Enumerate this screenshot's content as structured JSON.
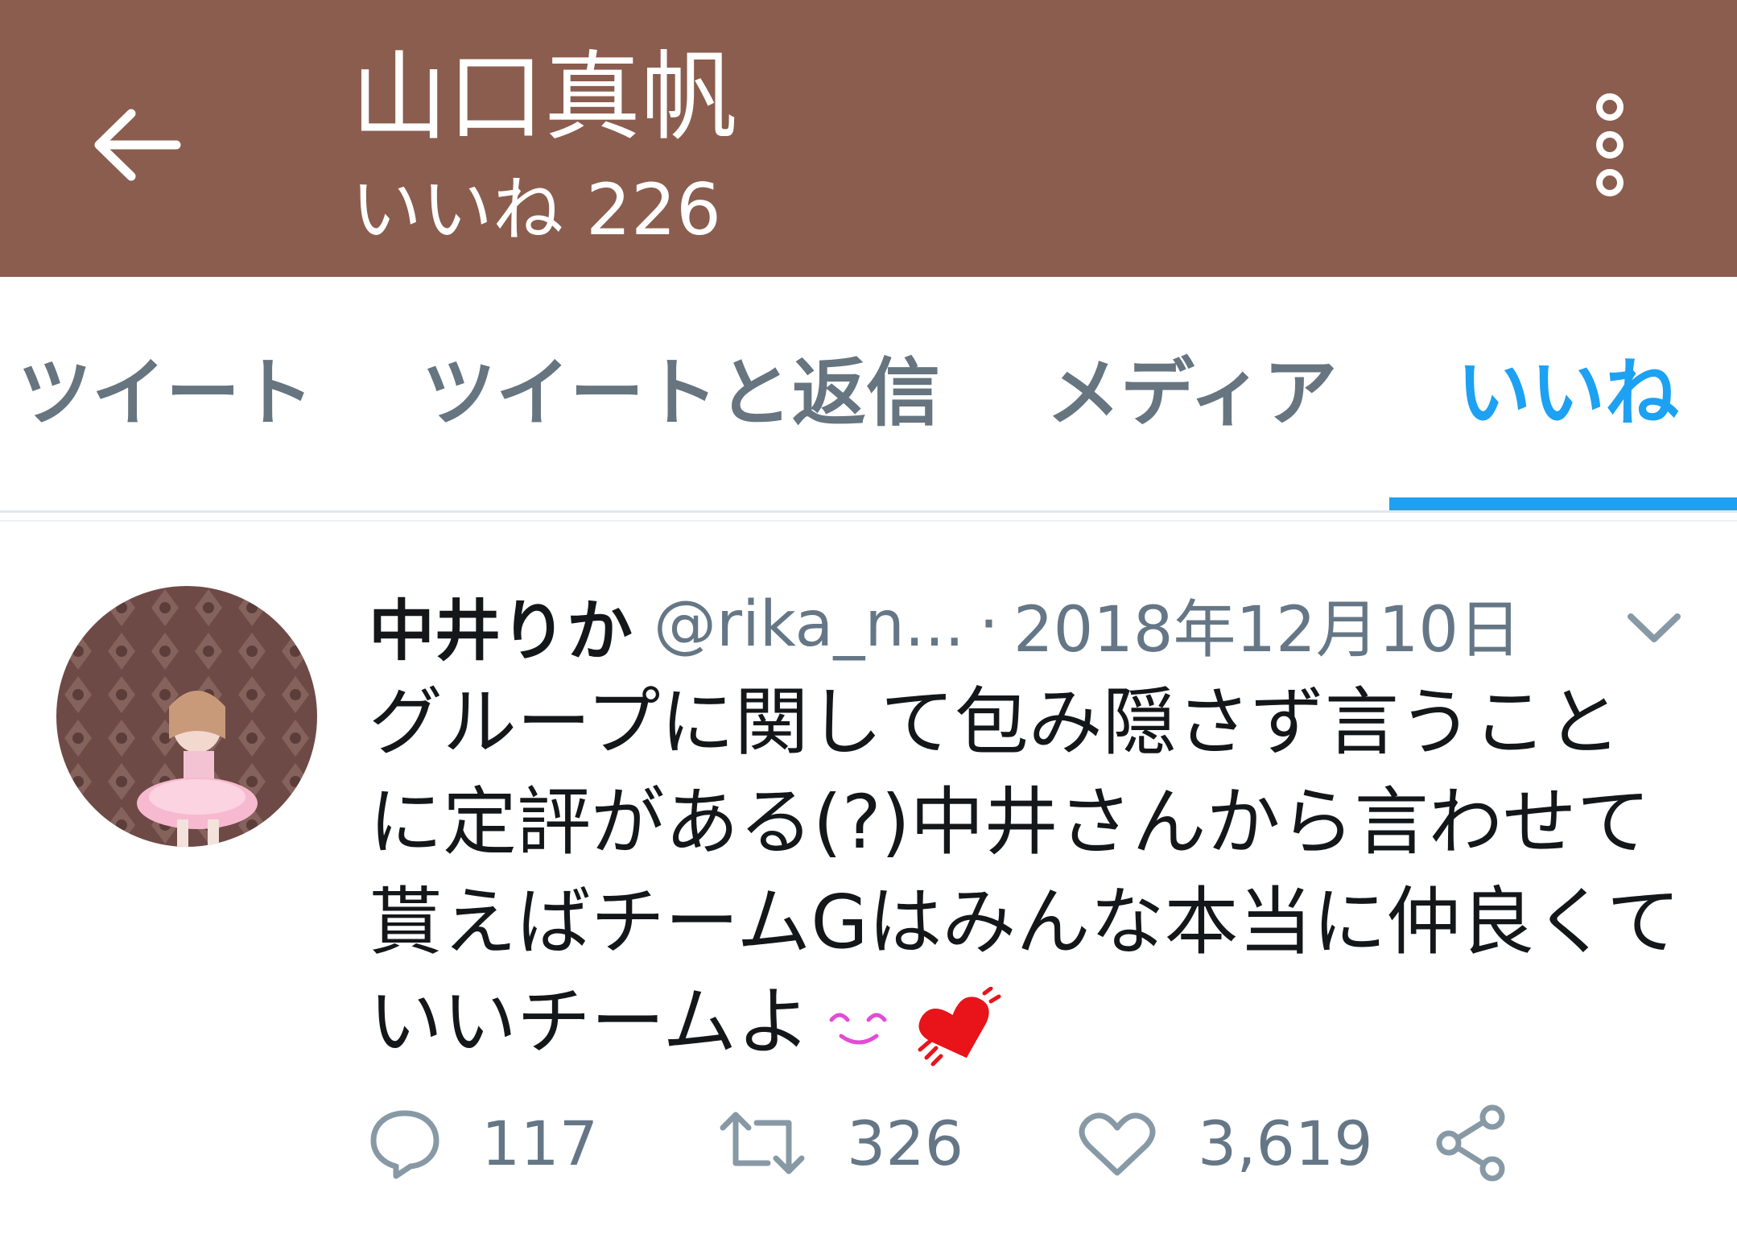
{
  "appbar": {
    "title": "山口真帆",
    "subtitle": "いいね 226",
    "background": "#8b5d4e",
    "back_icon": "arrow-left-icon",
    "more_icon": "more-vertical-icon"
  },
  "tabs": [
    {
      "label": "ツイート",
      "active": false
    },
    {
      "label": "ツイートと返信",
      "active": false
    },
    {
      "label": "メディア",
      "active": false
    },
    {
      "label": "いいね",
      "active": true
    }
  ],
  "accent_color": "#1da1f2",
  "tweet": {
    "author_name": "中井りか",
    "handle": "@rika_n...",
    "separator": "·",
    "date": "2018年12月10日",
    "text": "グループに関して包み隠さず言うことに定評がある(?)中井さんから言わせて貰えばチームGはみんな本当に仲良くていいチームよ",
    "emojis": [
      "smiling-eyes-emoji",
      "heart-emoji"
    ],
    "actions": {
      "reply": {
        "icon": "reply-icon",
        "count": "117"
      },
      "retweet": {
        "icon": "retweet-icon",
        "count": "326"
      },
      "like": {
        "icon": "heart-outline-icon",
        "count": "3,619"
      },
      "share": {
        "icon": "share-icon"
      }
    }
  }
}
